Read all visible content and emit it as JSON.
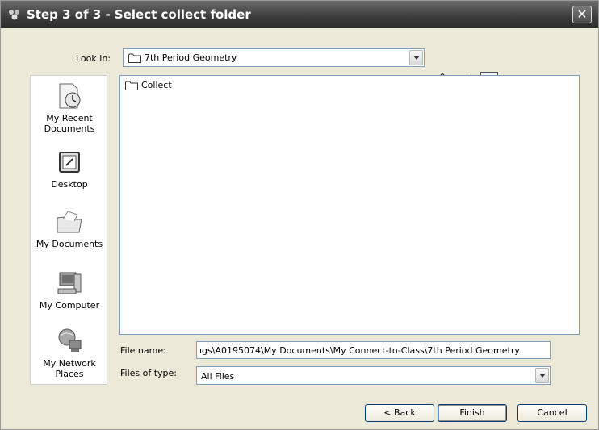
{
  "window": {
    "title": "Step 3 of 3 - Select collect folder",
    "close_label": "✕"
  },
  "look_in": {
    "label": "Look in:",
    "value": "7th Period Geometry"
  },
  "places": [
    {
      "label": "My Recent Documents",
      "icon": "recent-documents-icon"
    },
    {
      "label": "Desktop",
      "icon": "desktop-icon"
    },
    {
      "label": "My Documents",
      "icon": "my-documents-icon"
    },
    {
      "label": "My Computer",
      "icon": "my-computer-icon"
    },
    {
      "label": "My Network Places",
      "icon": "network-places-icon"
    }
  ],
  "files": [
    {
      "name": "Collect",
      "icon": "folder-icon"
    }
  ],
  "file_name": {
    "label": "File name:",
    "value": "ıgs\\A0195074\\My Documents\\My Connect-to-Class\\7th Period Geometry"
  },
  "file_type": {
    "label": "Files of type:",
    "value": "All Files"
  },
  "buttons": {
    "back": "< Back",
    "finish": "Finish",
    "cancel": "Cancel"
  }
}
